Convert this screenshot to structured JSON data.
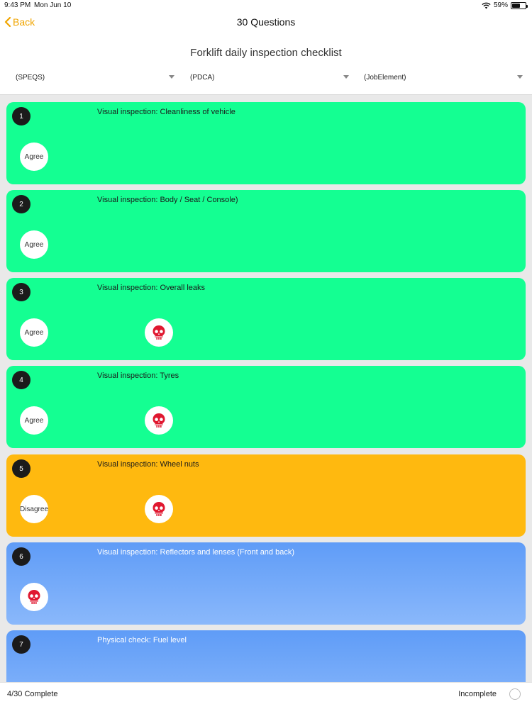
{
  "status_bar": {
    "time": "9:43 PM",
    "date": "Mon Jun 10",
    "battery": "59%",
    "battery_level": 0.59
  },
  "nav": {
    "back_label": "Back",
    "title": "30 Questions"
  },
  "checklist_title": "Forklift daily inspection checklist",
  "filters": [
    {
      "value": "(SPEQS)"
    },
    {
      "value": "(PDCA)"
    },
    {
      "value": "(JobElement)"
    }
  ],
  "colors": {
    "accent": "#f0a500",
    "agree_green": "#14ff92",
    "disagree_orange": "#ffb90f",
    "unanswered_blue": "#6fa7f8",
    "hazard_red": "#e01830"
  },
  "questions": [
    {
      "number": "1",
      "text": "Visual inspection: Cleanliness of vehicle",
      "answer": "Agree"
    },
    {
      "number": "2",
      "text": "Visual inspection: Body / Seat / Console)",
      "answer": "Agree"
    },
    {
      "number": "3",
      "text": "Visual inspection: Overall leaks",
      "answer": "Agree"
    },
    {
      "number": "4",
      "text": "Visual inspection: Tyres",
      "answer": "Agree"
    },
    {
      "number": "5",
      "text": "Visual inspection: Wheel nuts",
      "answer": "Disagree"
    },
    {
      "number": "6",
      "text": "Visual inspection: Reflectors and lenses (Front and back)",
      "answer": ""
    },
    {
      "number": "7",
      "text": "Physical check: Fuel level",
      "answer": ""
    }
  ],
  "hazard_icon": "skull-icon",
  "footer": {
    "progress": "4/30 Complete",
    "status": "Incomplete"
  }
}
